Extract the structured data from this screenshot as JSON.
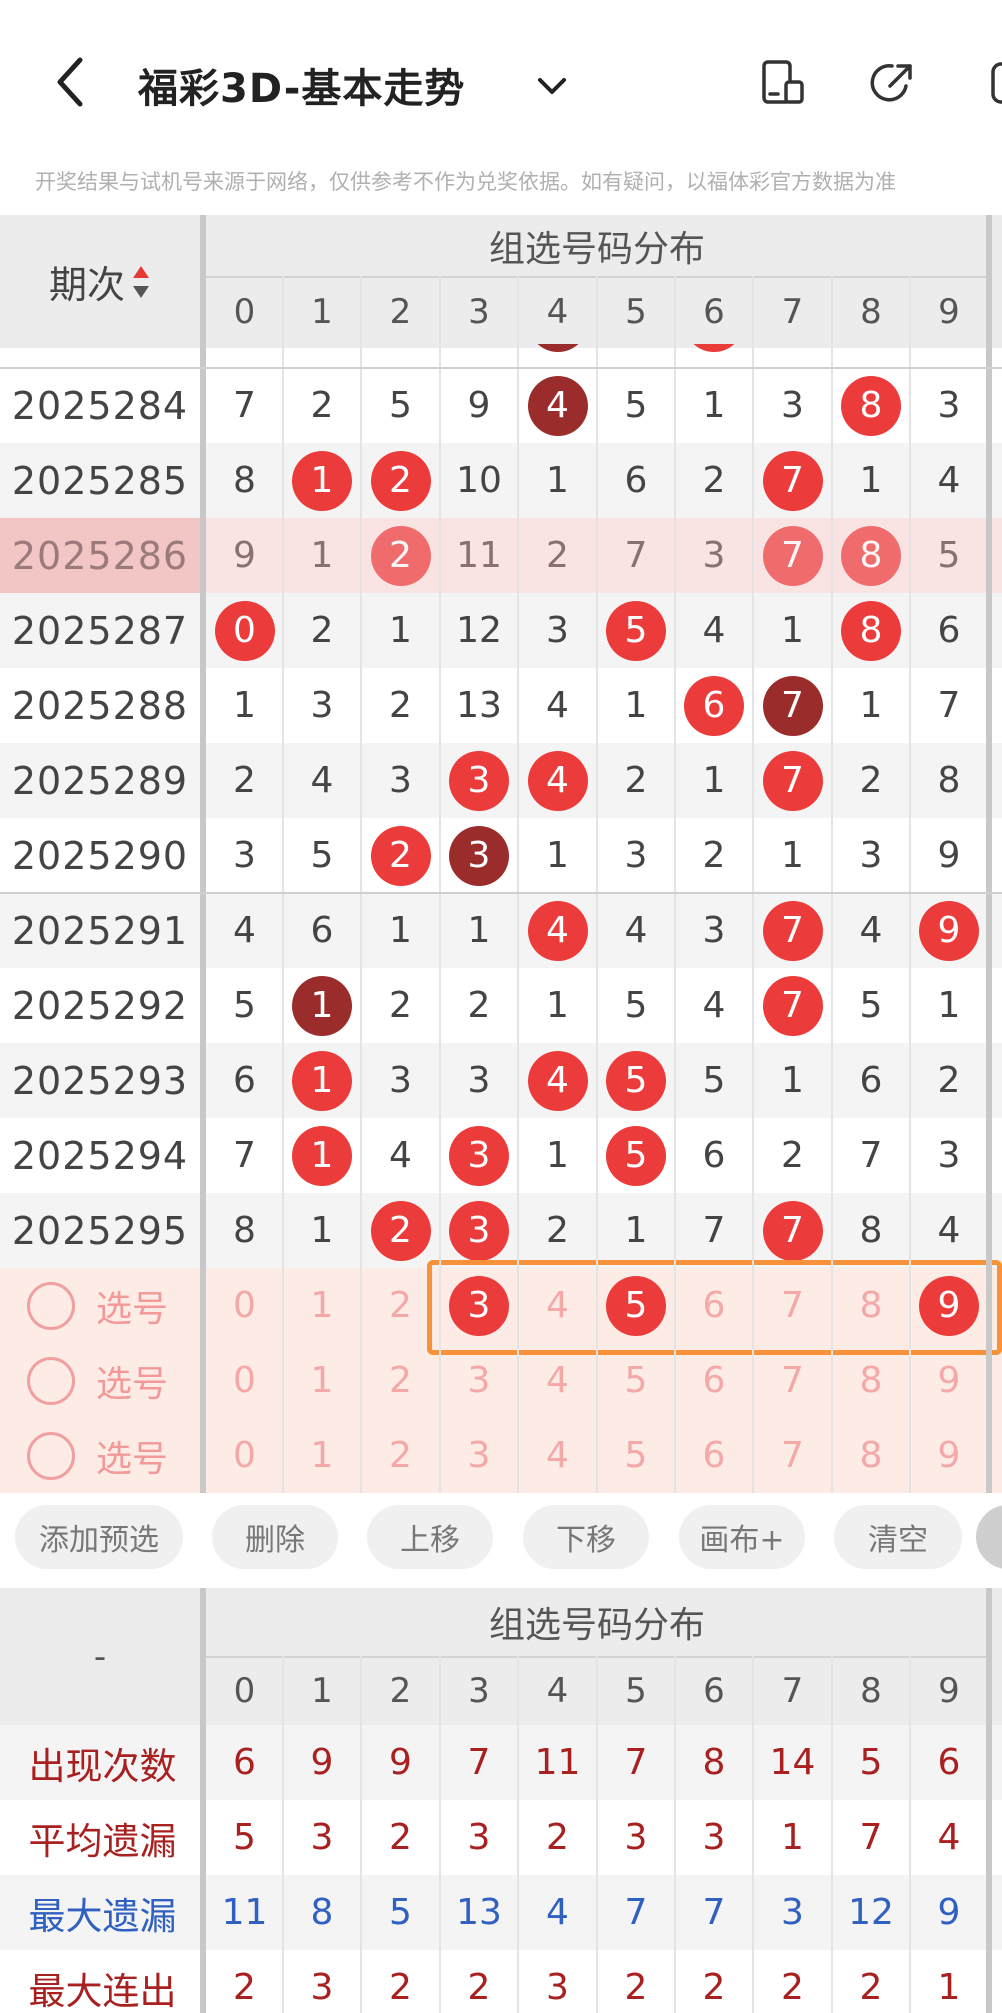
{
  "header": {
    "title": "福彩3D-基本走势",
    "back_icon": "back-arrow-icon",
    "dropdown_icon": "chevron-down-icon"
  },
  "disclaimer": "开奖结果与试机号来源于网络，仅供参考不作为兑奖依据。如有疑问，以福体彩官方数据为准",
  "table": {
    "period_header": "期次",
    "group_header": "组选号码分布",
    "digits": [
      "0",
      "1",
      "2",
      "3",
      "4",
      "5",
      "6",
      "7",
      "8",
      "9"
    ],
    "rows": [
      {
        "period": "2025284",
        "cells": [
          "7",
          "2",
          "5",
          "9",
          "4",
          "5",
          "1",
          "3",
          "8",
          "3"
        ],
        "balls": {
          "4": "dark",
          "8": "red"
        }
      },
      {
        "period": "2025285",
        "cells": [
          "8",
          "1",
          "2",
          "10",
          "1",
          "6",
          "2",
          "7",
          "1",
          "4"
        ],
        "balls": {
          "1": "red",
          "2": "red",
          "7": "red"
        }
      },
      {
        "period": "2025286",
        "cells": [
          "9",
          "1",
          "2",
          "11",
          "2",
          "7",
          "3",
          "7",
          "8",
          "5"
        ],
        "balls": {
          "2": "red",
          "7": "red",
          "8": "red"
        },
        "highlighted": true
      },
      {
        "period": "2025287",
        "cells": [
          "0",
          "2",
          "1",
          "12",
          "3",
          "5",
          "4",
          "1",
          "8",
          "6"
        ],
        "balls": {
          "0": "red",
          "5": "red",
          "8": "red"
        }
      },
      {
        "period": "2025288",
        "cells": [
          "1",
          "3",
          "2",
          "13",
          "4",
          "1",
          "6",
          "7",
          "1",
          "7"
        ],
        "balls": {
          "6": "red",
          "7": "dark"
        }
      },
      {
        "period": "2025289",
        "cells": [
          "2",
          "4",
          "3",
          "3",
          "4",
          "2",
          "1",
          "7",
          "2",
          "8"
        ],
        "balls": {
          "3": "red",
          "4": "red",
          "7": "red"
        }
      },
      {
        "period": "2025290",
        "cells": [
          "3",
          "5",
          "2",
          "3",
          "1",
          "3",
          "2",
          "1",
          "3",
          "9"
        ],
        "balls": {
          "2": "red",
          "3": "dark"
        }
      },
      {
        "period": "2025291",
        "cells": [
          "4",
          "6",
          "1",
          "1",
          "4",
          "4",
          "3",
          "7",
          "4",
          "9"
        ],
        "balls": {
          "4": "red",
          "7": "red",
          "9": "red"
        }
      },
      {
        "period": "2025292",
        "cells": [
          "5",
          "1",
          "2",
          "2",
          "1",
          "5",
          "4",
          "7",
          "5",
          "1"
        ],
        "balls": {
          "1": "dark",
          "7": "red"
        }
      },
      {
        "period": "2025293",
        "cells": [
          "6",
          "1",
          "3",
          "3",
          "4",
          "5",
          "5",
          "1",
          "6",
          "2"
        ],
        "balls": {
          "1": "red",
          "4": "red",
          "5": "red"
        }
      },
      {
        "period": "2025294",
        "cells": [
          "7",
          "1",
          "4",
          "3",
          "1",
          "5",
          "6",
          "2",
          "7",
          "3"
        ],
        "balls": {
          "1": "red",
          "3": "red",
          "5": "red"
        }
      },
      {
        "period": "2025295",
        "cells": [
          "8",
          "1",
          "2",
          "3",
          "2",
          "1",
          "7",
          "7",
          "8",
          "4"
        ],
        "balls": {
          "2": "red",
          "3": "red",
          "7": "red"
        }
      }
    ],
    "pick_rows": [
      {
        "label": "选号",
        "selected": [
          "3",
          "5",
          "9"
        ]
      },
      {
        "label": "选号",
        "selected": []
      },
      {
        "label": "选号",
        "selected": []
      }
    ]
  },
  "buttons": [
    "添加预选",
    "删除",
    "上移",
    "下移",
    "画布+",
    "清空"
  ],
  "stats": {
    "corner": "-",
    "group_header": "组选号码分布",
    "rows": [
      {
        "label": "出现次数",
        "color": "#a82020",
        "values": [
          "6",
          "9",
          "9",
          "7",
          "11",
          "7",
          "8",
          "14",
          "5",
          "6"
        ]
      },
      {
        "label": "平均遗漏",
        "color": "#a82020",
        "values": [
          "5",
          "3",
          "2",
          "3",
          "2",
          "3",
          "3",
          "1",
          "7",
          "4"
        ]
      },
      {
        "label": "最大遗漏",
        "color": "#3060c0",
        "values": [
          "11",
          "8",
          "5",
          "13",
          "4",
          "7",
          "7",
          "3",
          "12",
          "9"
        ]
      },
      {
        "label": "最大连出",
        "color": "#a82020",
        "values": [
          "2",
          "3",
          "2",
          "2",
          "3",
          "2",
          "2",
          "2",
          "2",
          "1"
        ]
      }
    ]
  },
  "colors": {
    "ball_red": "#ec3b3b",
    "ball_dark": "#9b2c2c",
    "highlight_border": "#f7913a",
    "pick_bg": "#fdebe6"
  }
}
